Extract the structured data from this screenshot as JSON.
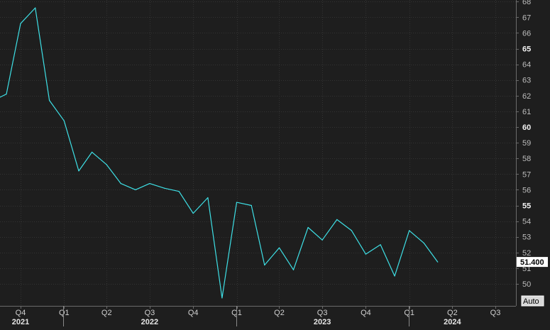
{
  "chart_data": {
    "type": "line",
    "ylim": [
      48.6,
      68.1
    ],
    "y_ticks": [
      50,
      51,
      52,
      53,
      54,
      55,
      56,
      57,
      58,
      59,
      60,
      61,
      62,
      63,
      64,
      65,
      66,
      67,
      68
    ],
    "y_bold_ticks": [
      55,
      60,
      65
    ],
    "x_quarter_ticks": [
      {
        "label": "Q4",
        "date": "2021-10-01"
      },
      {
        "label": "Q1",
        "date": "2022-01-01"
      },
      {
        "label": "Q2",
        "date": "2022-04-01"
      },
      {
        "label": "Q3",
        "date": "2022-07-01"
      },
      {
        "label": "Q4",
        "date": "2022-10-01"
      },
      {
        "label": "Q1",
        "date": "2023-01-01"
      },
      {
        "label": "Q2",
        "date": "2023-04-01"
      },
      {
        "label": "Q3",
        "date": "2023-07-01"
      },
      {
        "label": "Q4",
        "date": "2023-10-01"
      },
      {
        "label": "Q1",
        "date": "2024-01-01"
      },
      {
        "label": "Q2",
        "date": "2024-04-01"
      },
      {
        "label": "Q3",
        "date": "2024-07-01"
      }
    ],
    "x_year_labels": [
      {
        "label": "2021",
        "date": "2021-10-01"
      },
      {
        "label": "2022",
        "date": "2022-07-01"
      },
      {
        "label": "2023",
        "date": "2023-07-01"
      },
      {
        "label": "2024",
        "date": "2024-04-01"
      }
    ],
    "x_year_dividers": [
      "2022-01-01",
      "2023-01-01",
      "2024-01-01"
    ],
    "series": [
      {
        "color": "#3ee0e6",
        "points": [
          {
            "date": "2021-08-01",
            "value": 61.9
          },
          {
            "date": "2021-09-01",
            "value": 62.1
          },
          {
            "date": "2021-10-01",
            "value": 66.6
          },
          {
            "date": "2021-11-01",
            "value": 67.6
          },
          {
            "date": "2021-12-01",
            "value": 61.7
          },
          {
            "date": "2022-01-01",
            "value": 60.4
          },
          {
            "date": "2022-02-01",
            "value": 57.2
          },
          {
            "date": "2022-03-01",
            "value": 58.4
          },
          {
            "date": "2022-04-01",
            "value": 57.6
          },
          {
            "date": "2022-05-01",
            "value": 56.4
          },
          {
            "date": "2022-06-01",
            "value": 56.0
          },
          {
            "date": "2022-07-01",
            "value": 56.4
          },
          {
            "date": "2022-08-01",
            "value": 56.1
          },
          {
            "date": "2022-09-01",
            "value": 55.9
          },
          {
            "date": "2022-10-01",
            "value": 54.5
          },
          {
            "date": "2022-11-01",
            "value": 55.5
          },
          {
            "date": "2022-12-01",
            "value": 49.1
          },
          {
            "date": "2023-01-01",
            "value": 55.2
          },
          {
            "date": "2023-02-01",
            "value": 55.0
          },
          {
            "date": "2023-03-01",
            "value": 51.2
          },
          {
            "date": "2023-04-01",
            "value": 52.3
          },
          {
            "date": "2023-05-01",
            "value": 50.9
          },
          {
            "date": "2023-06-01",
            "value": 53.6
          },
          {
            "date": "2023-07-01",
            "value": 52.8
          },
          {
            "date": "2023-08-01",
            "value": 54.1
          },
          {
            "date": "2023-09-01",
            "value": 53.4
          },
          {
            "date": "2023-10-01",
            "value": 51.9
          },
          {
            "date": "2023-11-01",
            "value": 52.5
          },
          {
            "date": "2023-12-01",
            "value": 50.5
          },
          {
            "date": "2024-01-01",
            "value": 53.4
          },
          {
            "date": "2024-02-01",
            "value": 52.6
          },
          {
            "date": "2024-03-01",
            "value": 51.4
          }
        ]
      }
    ],
    "last_value_label": "51.400",
    "auto_label": "Auto",
    "grid": true
  }
}
